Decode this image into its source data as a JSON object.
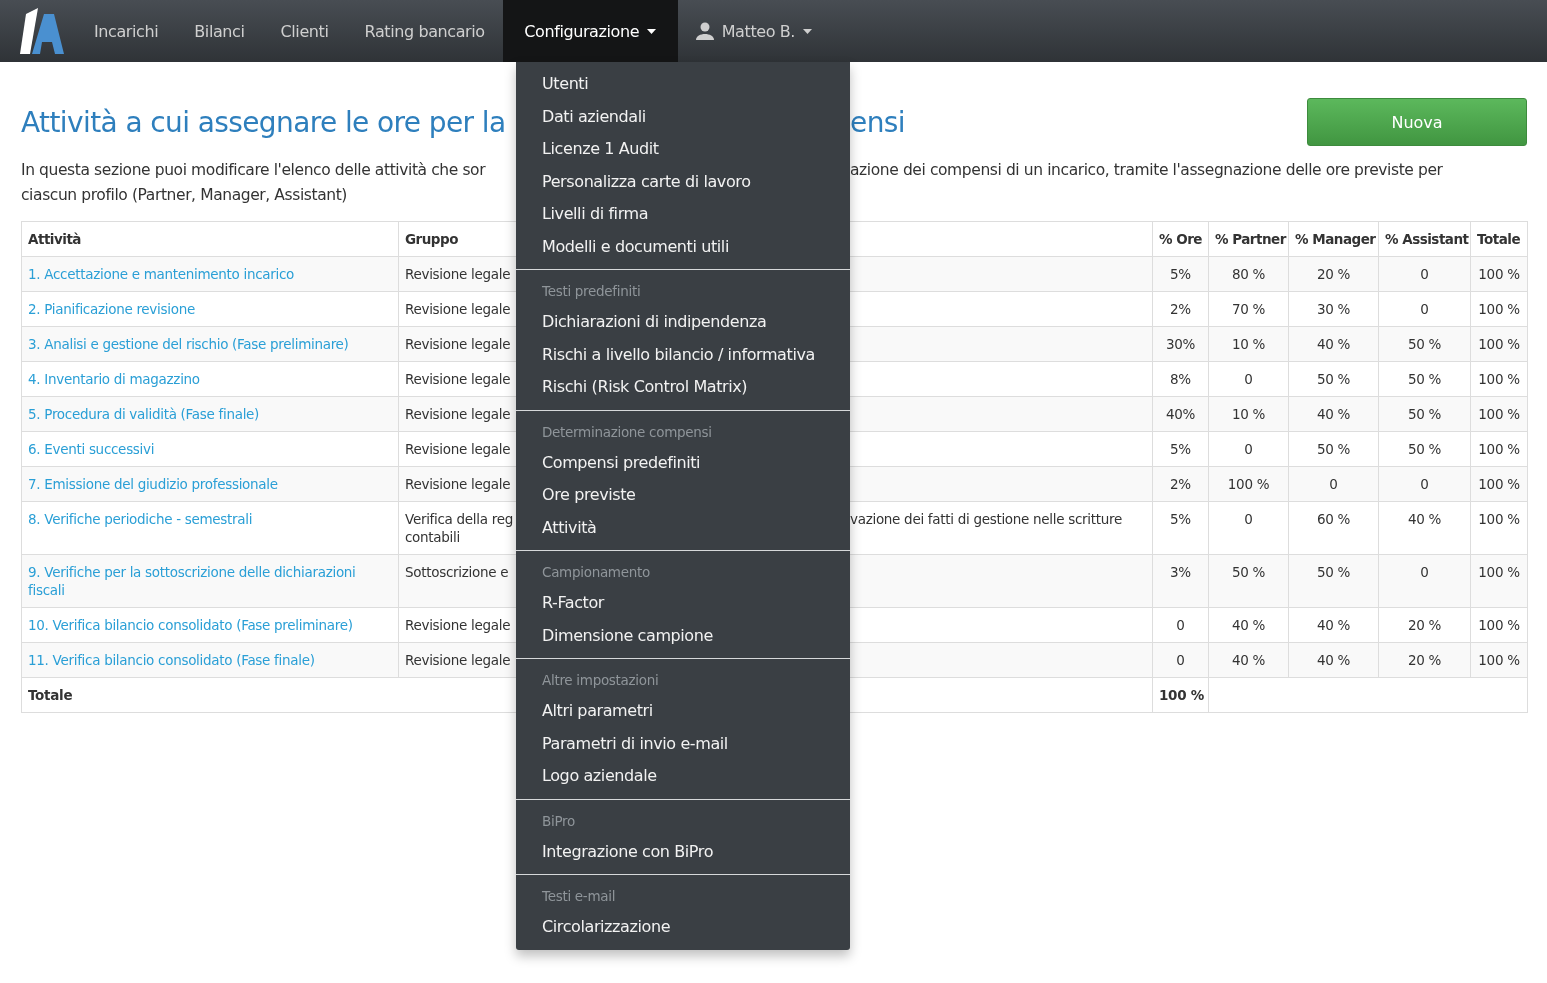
{
  "nav": {
    "items": [
      {
        "label": "Incarichi",
        "selected": false
      },
      {
        "label": "Bilanci",
        "selected": false
      },
      {
        "label": "Clienti",
        "selected": false
      },
      {
        "label": "Rating bancario",
        "selected": false
      },
      {
        "label": "Configurazione",
        "selected": true,
        "expanded": true
      }
    ],
    "user": {
      "label": "Matteo B."
    }
  },
  "page": {
    "title_start": "Attività a cui assegnare le ore per la",
    "title_end": "ensi",
    "new_button": "Nuova",
    "intro_line1_start": "In questa sezione puoi modificare l'elenco delle attività che sor",
    "intro_line1_end": "azione dei compensi di un incarico, tramite l'assegnazione delle ore previste per",
    "intro_line2": "ciascun profilo (Partner, Manager, Assistant)"
  },
  "table": {
    "columns": [
      "Attività",
      "Gruppo",
      "% Ore",
      "% Partner",
      "% Manager",
      "% Assistant",
      "Totale"
    ],
    "rows": [
      {
        "attivita": "1. Accettazione e mantenimento incarico",
        "gruppo": [
          "Revisione legale"
        ],
        "ore": "5%",
        "partner": "80 %",
        "manager": "20 %",
        "assistant": "0",
        "totale": "100 %"
      },
      {
        "attivita": "2. Pianificazione revisione",
        "gruppo": [
          "Revisione legale"
        ],
        "ore": "2%",
        "partner": "70 %",
        "manager": "30 %",
        "assistant": "0",
        "totale": "100 %"
      },
      {
        "attivita": "3. Analisi e gestione del rischio (Fase preliminare)",
        "gruppo": [
          "Revisione legale"
        ],
        "ore": "30%",
        "partner": "10 %",
        "manager": "40 %",
        "assistant": "50 %",
        "totale": "100 %"
      },
      {
        "attivita": "4. Inventario di magazzino",
        "gruppo": [
          "Revisione legale"
        ],
        "ore": "8%",
        "partner": "0",
        "manager": "50 %",
        "assistant": "50 %",
        "totale": "100 %"
      },
      {
        "attivita": "5. Procedura di validità (Fase finale)",
        "gruppo": [
          "Revisione legale"
        ],
        "ore": "40%",
        "partner": "10 %",
        "manager": "40 %",
        "assistant": "50 %",
        "totale": "100 %"
      },
      {
        "attivita": "6. Eventi successivi",
        "gruppo": [
          "Revisione legale"
        ],
        "ore": "5%",
        "partner": "0",
        "manager": "50 %",
        "assistant": "50 %",
        "totale": "100 %"
      },
      {
        "attivita": "7. Emissione del giudizio professionale",
        "gruppo": [
          "Revisione legale"
        ],
        "ore": "2%",
        "partner": "100 %",
        "manager": "0",
        "assistant": "0",
        "totale": "100 %"
      },
      {
        "attivita": "8. Verifiche periodiche - semestrali",
        "gruppo": [
          "Verifica della reg",
          "contabili"
        ],
        "gruppo_end": "vazione dei fatti di gestione nelle scritture",
        "ore": "5%",
        "partner": "0",
        "manager": "60 %",
        "assistant": "40 %",
        "totale": "100 %"
      },
      {
        "attivita": "9. Verifiche per la sottoscrizione delle dichiarazioni fiscali",
        "gruppo": [
          "Sottoscrizione e"
        ],
        "ore": "3%",
        "partner": "50 %",
        "manager": "50 %",
        "assistant": "0",
        "totale": "100 %"
      },
      {
        "attivita": "10. Verifica bilancio consolidato (Fase preliminare)",
        "gruppo": [
          "Revisione legale"
        ],
        "ore": "0",
        "partner": "40 %",
        "manager": "40 %",
        "assistant": "20 %",
        "totale": "100 %"
      },
      {
        "attivita": "11. Verifica bilancio consolidato (Fase finale)",
        "gruppo": [
          "Revisione legale"
        ],
        "ore": "0",
        "partner": "40 %",
        "manager": "40 %",
        "assistant": "20 %",
        "totale": "100 %"
      }
    ],
    "total": {
      "label": "Totale",
      "ore": "100 %"
    }
  },
  "menu": {
    "sections": [
      {
        "items": [
          "Utenti",
          "Dati aziendali",
          "Licenze 1 Audit",
          "Personalizza carte di lavoro",
          "Livelli di firma",
          "Modelli e documenti utili"
        ]
      },
      {
        "header": "Testi predefiniti",
        "items": [
          "Dichiarazioni di indipendenza",
          "Rischi a livello bilancio / informativa",
          "Rischi (Risk Control Matrix)"
        ]
      },
      {
        "header": "Determinazione compensi",
        "items": [
          "Compensi predefiniti",
          "Ore previste",
          "Attività"
        ]
      },
      {
        "header": "Campionamento",
        "items": [
          "R-Factor",
          "Dimensione campione"
        ]
      },
      {
        "header": "Altre impostazioni",
        "items": [
          "Altri parametri",
          "Parametri di invio e-mail",
          "Logo aziendale"
        ]
      },
      {
        "header": "BiPro",
        "items": [
          "Integrazione con BiPro"
        ]
      },
      {
        "header": "Testi e-mail",
        "items": [
          "Circolarizzazione"
        ]
      }
    ]
  }
}
